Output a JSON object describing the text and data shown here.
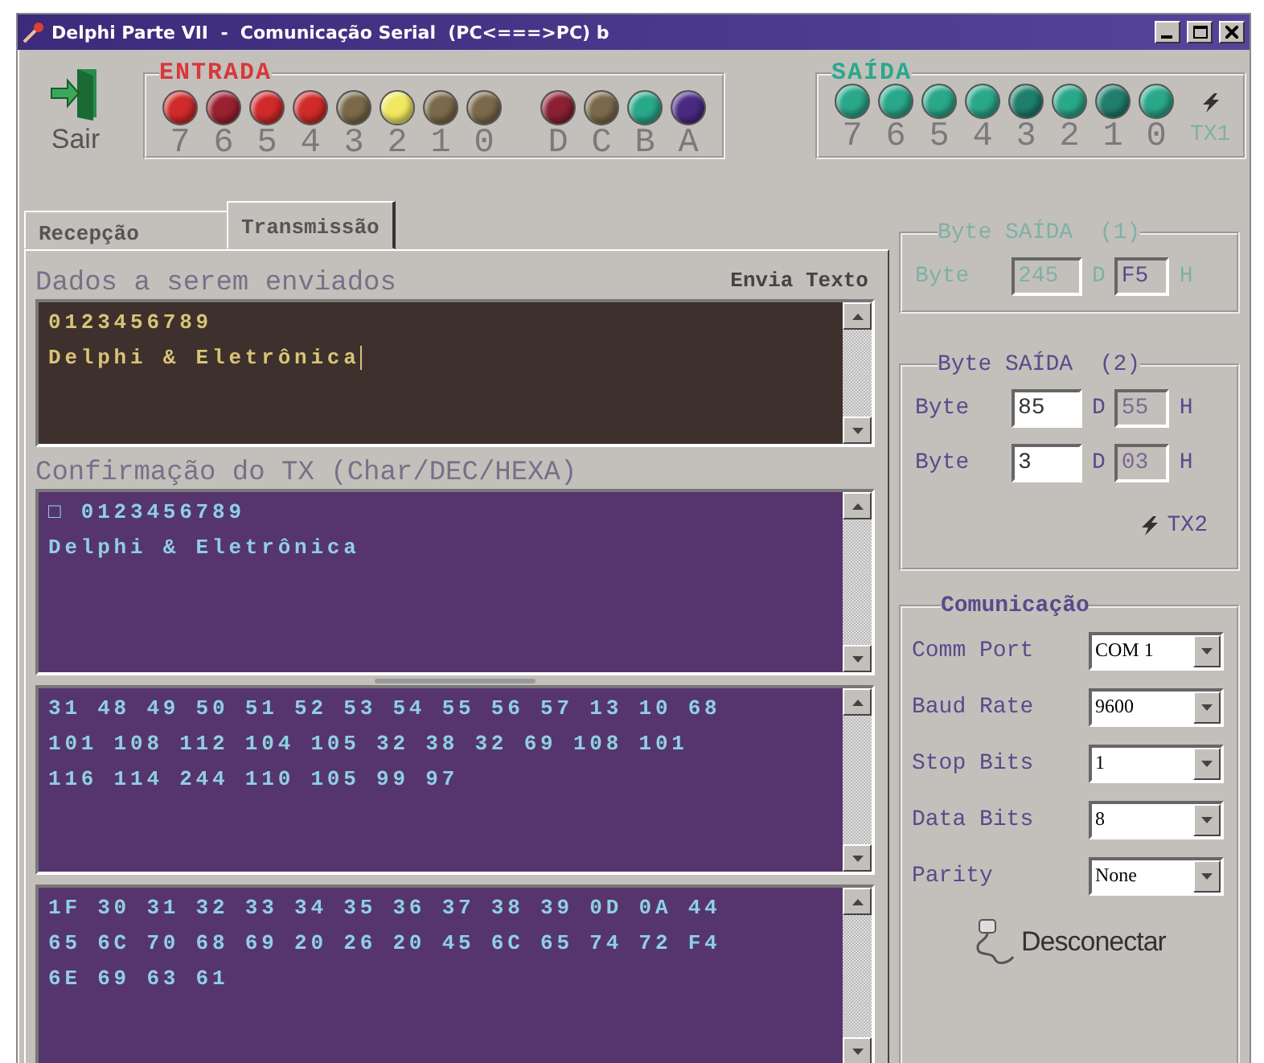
{
  "window": {
    "title": "Delphi Parte VII  -  Comunicação Serial  (PC<===>PC) b"
  },
  "exit_button": {
    "label": "Sair"
  },
  "entrada": {
    "title": "ENTRADA",
    "groups": [
      [
        {
          "label": "7",
          "color": "#d02a2a"
        },
        {
          "label": "6",
          "color": "#9a2230"
        },
        {
          "label": "5",
          "color": "#d02a2a"
        },
        {
          "label": "4",
          "color": "#d02a2a"
        },
        {
          "label": "3",
          "color": "#7a6a4a"
        },
        {
          "label": "2",
          "color": "#f0e860"
        },
        {
          "label": "1",
          "color": "#7a6a4a"
        },
        {
          "label": "0",
          "color": "#7a6a4a"
        }
      ],
      [
        {
          "label": "D",
          "color": "#8a2032"
        },
        {
          "label": "C",
          "color": "#7a6a4a"
        },
        {
          "label": "B",
          "color": "#2aa88a"
        },
        {
          "label": "A",
          "color": "#4a2a80"
        }
      ]
    ]
  },
  "saida": {
    "title": "SAÍDA",
    "bits": [
      {
        "label": "7",
        "color": "#2aa88a"
      },
      {
        "label": "6",
        "color": "#2aa88a"
      },
      {
        "label": "5",
        "color": "#2aa88a"
      },
      {
        "label": "4",
        "color": "#2aa88a"
      },
      {
        "label": "3",
        "color": "#1f7e6c"
      },
      {
        "label": "2",
        "color": "#2aa88a"
      },
      {
        "label": "1",
        "color": "#1f7e6c"
      },
      {
        "label": "0",
        "color": "#2aa88a"
      }
    ],
    "tx": {
      "label": "TX1",
      "disabled": true
    }
  },
  "tabs": [
    {
      "label": "Recepção",
      "selected": false
    },
    {
      "label": "Transmissão",
      "selected": true
    }
  ],
  "send": {
    "label": "Dados a serem enviados",
    "button": "Envia Texto",
    "lines": [
      "0123456789",
      "Delphi & Eletrônica"
    ]
  },
  "confirm": {
    "label": "Confirmação do TX (Char/DEC/HEXA)",
    "lines": [
      "□ 0123456789",
      "Delphi & Eletrônica"
    ]
  },
  "dec_memo": {
    "lines": [
      "31 48 49 50 51 52 53 54 55 56 57 13 10 68",
      "101 108 112 104 105 32 38 32 69 108 101",
      "116 114 244 110 105 99 97"
    ]
  },
  "hex_memo": {
    "lines": [
      "1F 30 31 32 33 34 35 36 37 38 39 0D 0A 44",
      "65 6C 70 68 69 20 26 20 45 6C 65 74 72 F4",
      "6E 69 63 61"
    ]
  },
  "byte_groups": [
    {
      "title": "Byte SAÍDA  (1)",
      "disabled": true,
      "rows": [
        {
          "label": "Byte",
          "dec": "245",
          "dec_unit": "D",
          "hex": "F5",
          "hex_unit": "H"
        }
      ]
    },
    {
      "title": "Byte SAÍDA  (2)",
      "disabled": false,
      "rows": [
        {
          "label": "Byte",
          "dec": "85",
          "dec_unit": "D",
          "hex": "55",
          "hex_unit": "H"
        },
        {
          "label": "Byte",
          "dec": "3",
          "dec_unit": "D",
          "hex": "03",
          "hex_unit": "H"
        }
      ],
      "tx": {
        "label": "TX2",
        "disabled": false
      }
    }
  ],
  "communication": {
    "title": "Comunicação",
    "settings": [
      {
        "label": "Comm Port",
        "value": "COM 1"
      },
      {
        "label": "Baud Rate",
        "value": "9600"
      },
      {
        "label": "Stop Bits",
        "value": "1"
      },
      {
        "label": "Data Bits",
        "value": "8"
      },
      {
        "label": "Parity",
        "value": "None"
      }
    ],
    "disconnect": "Desconectar"
  }
}
